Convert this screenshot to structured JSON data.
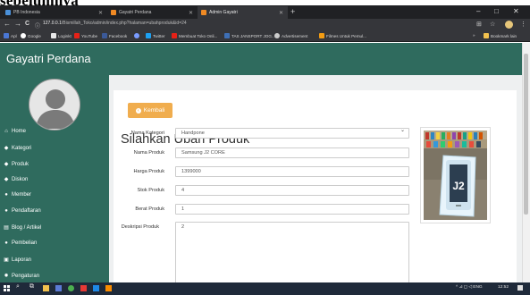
{
  "caption": "sebelumnya",
  "browser": {
    "tabs": [
      {
        "label": "PB Indonesia",
        "color": "#4a90d9"
      },
      {
        "label": "Gayatri Perdana",
        "color": "#f08a24"
      },
      {
        "label": "Admin Gayatri",
        "color": "#f08a24"
      }
    ],
    "new_tab": "+",
    "window": {
      "minimize": "–",
      "maximize": "□",
      "close": "✕"
    },
    "nav": {
      "back": "←",
      "forward": "→",
      "reload": "C"
    },
    "url_host": "127.0.0.1",
    "url_path": "/Bismillah_Toko/admin/index.php?halaman=ubahproduk&id=24",
    "bookmarks": [
      {
        "label": "Apl",
        "color": "#4a77d4"
      },
      {
        "label": "Google",
        "color": "#ffffff"
      },
      {
        "label": "Loginkt",
        "color": "#e8e8e8"
      },
      {
        "label": "YouTube",
        "color": "#e62117"
      },
      {
        "label": "Facebook",
        "color": "#3b5998"
      },
      {
        "label": "",
        "color": "#7a9cff"
      },
      {
        "label": "Twitter",
        "color": "#1da1f2"
      },
      {
        "label": "Membuat Toko Onli...",
        "color": "#e62117"
      },
      {
        "label": "TAS JANSPORT JOG...",
        "color": "#3e6fb5"
      },
      {
        "label": "Advertisement",
        "color": "#cccccc"
      },
      {
        "label": "Filmes Untuk Pemul...",
        "color": "#f39c12"
      }
    ],
    "bookmarks_more": "»",
    "bookmarks_other": "Bookmark lain"
  },
  "app": {
    "brand": "Gayatri Perdana",
    "menu": [
      {
        "icon": "home-icon",
        "glyph": "⌂",
        "label": "Home"
      },
      {
        "icon": "tag-icon",
        "glyph": "◆",
        "label": "Kategori"
      },
      {
        "icon": "tag-icon",
        "glyph": "◆",
        "label": "Produk"
      },
      {
        "icon": "tag-icon",
        "glyph": "◆",
        "label": "Diskon"
      },
      {
        "icon": "user-icon",
        "glyph": "●",
        "label": "Member"
      },
      {
        "icon": "user-icon",
        "glyph": "●",
        "label": "Pendaftaran"
      },
      {
        "icon": "list-icon",
        "glyph": "▤",
        "label": "Blog / Artikel"
      },
      {
        "icon": "globe-icon",
        "glyph": "●",
        "label": "Pembelian"
      },
      {
        "icon": "print-icon",
        "glyph": "▣",
        "label": "Laporan"
      },
      {
        "icon": "gear-icon",
        "glyph": "✹",
        "label": "Pengaturan"
      }
    ],
    "back_button": "Kembali",
    "page_title": "Silahkan Ubah Produk",
    "form": {
      "kategori_label": "Nama Kategori",
      "kategori_value": "Handpone",
      "nama_label": "Nama Produk",
      "nama_value": "Samsung J2 CORE",
      "harga_label": "Harga Produk",
      "harga_value": "1399000",
      "stok_label": "Stok Produk",
      "stok_value": "4",
      "berat_label": "Berat Produk",
      "berat_value": "1",
      "deskripsi_label": "Deskripsi Produk",
      "deskripsi_value": "2"
    },
    "photo_text": "J2"
  },
  "taskbar": {
    "tray_text": "^ ⊿ ◻ ◁ ENG",
    "clock": "12:52"
  }
}
